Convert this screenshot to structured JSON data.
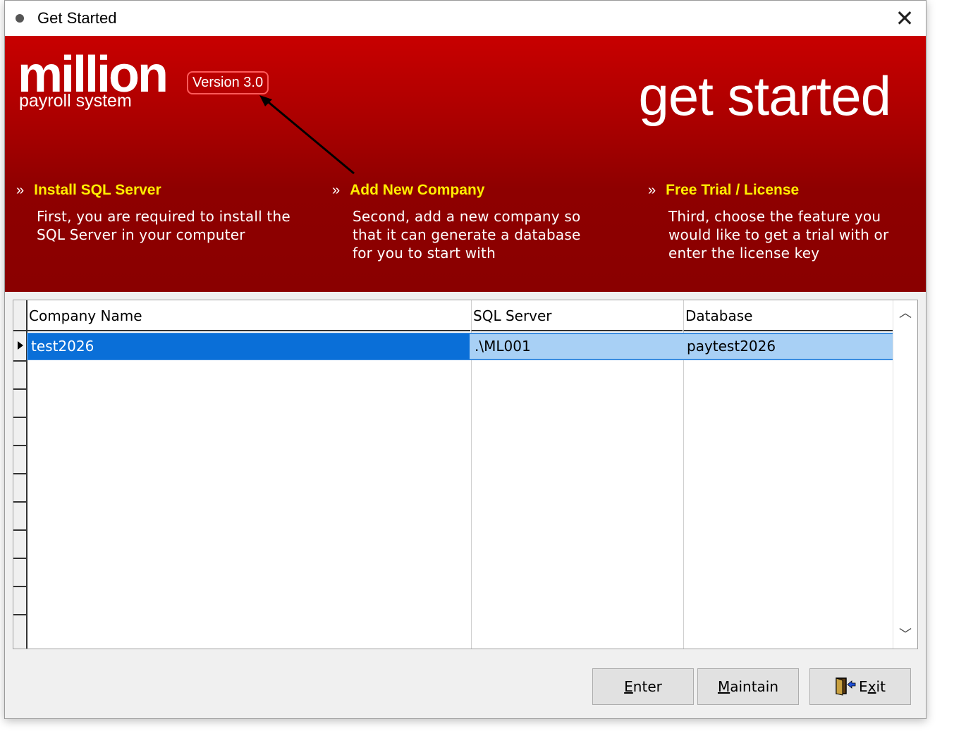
{
  "window": {
    "title": "Get Started"
  },
  "banner": {
    "logo": "million",
    "logo_sub": "payroll system",
    "version": "Version 3.0",
    "heading": "get started",
    "steps": [
      {
        "title": "Install SQL Server",
        "desc": "First, you are required to install the SQL Server in your computer"
      },
      {
        "title": "Add New Company",
        "desc": "Second, add a new company so that it can generate a database for you to start with"
      },
      {
        "title": "Free Trial / License",
        "desc": "Third, choose the feature you would like to get a trial with or enter the license key"
      }
    ]
  },
  "table": {
    "columns": [
      "Company Name",
      "SQL Server",
      "Database"
    ],
    "rows": [
      [
        "test2026",
        ".\\ML001",
        "paytest2026"
      ]
    ]
  },
  "buttons": {
    "enter": {
      "prefix": "",
      "mnemonic": "E",
      "rest": "nter"
    },
    "maintain": {
      "prefix": "",
      "mnemonic": "M",
      "rest": "aintain"
    },
    "exit": {
      "prefix": "E",
      "mnemonic": "x",
      "rest": "it"
    }
  },
  "colors": {
    "banner": "#b00000",
    "accent": "#ffee00",
    "selection": "#0a6fd8"
  }
}
